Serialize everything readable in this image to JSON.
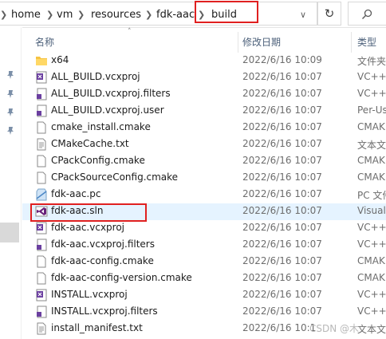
{
  "address": {
    "crumbs": [
      "home",
      "vm",
      "resources",
      "fdk-aac",
      "build"
    ]
  },
  "search_placeholder": "",
  "columns": {
    "name": "名称",
    "date": "修改日期",
    "type": "类型"
  },
  "files": [
    {
      "name": "x64",
      "date": "2022/6/16 10:09",
      "type": "文件夹",
      "icon": "folder-icon"
    },
    {
      "name": "ALL_BUILD.vcxproj",
      "date": "2022/6/16 10:07",
      "type": "VC++",
      "icon": "vcxproj-icon"
    },
    {
      "name": "ALL_BUILD.vcxproj.filters",
      "date": "2022/6/16 10:07",
      "type": "VC++",
      "icon": "filters-icon"
    },
    {
      "name": "ALL_BUILD.vcxproj.user",
      "date": "2022/6/16 10:07",
      "type": "Per-Us",
      "icon": "filters-icon"
    },
    {
      "name": "cmake_install.cmake",
      "date": "2022/6/16 10:07",
      "type": "CMAK",
      "icon": "document-icon"
    },
    {
      "name": "CMakeCache.txt",
      "date": "2022/6/16 10:07",
      "type": "文本文",
      "icon": "text-file-icon"
    },
    {
      "name": "CPackConfig.cmake",
      "date": "2022/6/16 10:07",
      "type": "CMAK",
      "icon": "document-icon"
    },
    {
      "name": "CPackSourceConfig.cmake",
      "date": "2022/6/16 10:07",
      "type": "CMAK",
      "icon": "document-icon"
    },
    {
      "name": "fdk-aac.pc",
      "date": "2022/6/16 10:07",
      "type": "PC 文件",
      "icon": "pc-file-icon"
    },
    {
      "name": "fdk-aac.sln",
      "date": "2022/6/16 10:07",
      "type": "Visual",
      "icon": "visual-studio-icon"
    },
    {
      "name": "fdk-aac.vcxproj",
      "date": "2022/6/16 10:07",
      "type": "VC++",
      "icon": "vcxproj-icon"
    },
    {
      "name": "fdk-aac.vcxproj.filters",
      "date": "2022/6/16 10:07",
      "type": "VC++",
      "icon": "filters-icon"
    },
    {
      "name": "fdk-aac-config.cmake",
      "date": "2022/6/16 10:07",
      "type": "CMAK",
      "icon": "document-icon"
    },
    {
      "name": "fdk-aac-config-version.cmake",
      "date": "2022/6/16 10:07",
      "type": "CMAK",
      "icon": "document-icon"
    },
    {
      "name": "INSTALL.vcxproj",
      "date": "2022/6/16 10:07",
      "type": "VC++",
      "icon": "vcxproj-icon"
    },
    {
      "name": "INSTALL.vcxproj.filters",
      "date": "2022/6/16 10:07",
      "type": "VC++",
      "icon": "filters-icon"
    },
    {
      "name": "install_manifest.txt",
      "date": "2022/6/16 10:1",
      "type": "文本文",
      "icon": "text-file-icon"
    }
  ],
  "selected_file": "fdk-aac.sln",
  "watermark": "CSDN @木",
  "colors": {
    "highlight_box": "#e02020",
    "selected_row": "#e5f3ff",
    "header_text": "#4c607a"
  }
}
